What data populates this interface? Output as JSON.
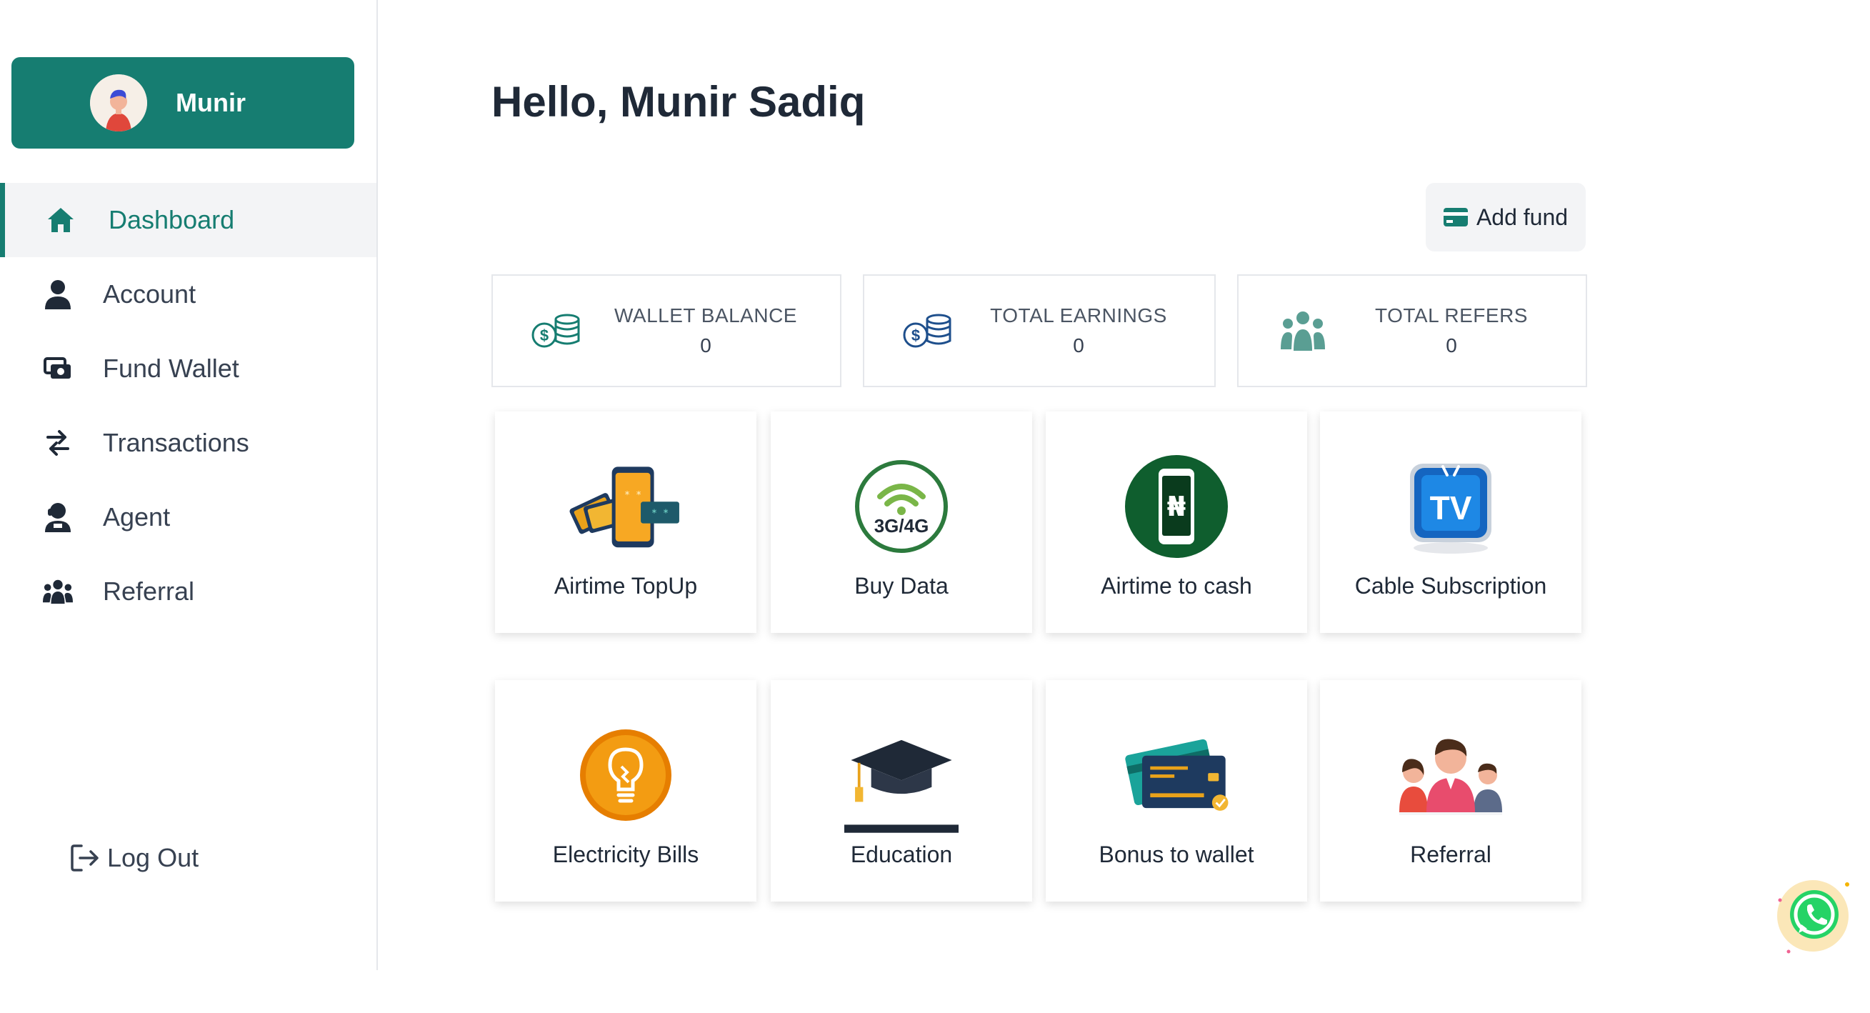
{
  "profile": {
    "name": "Munir"
  },
  "nav": {
    "items": [
      {
        "label": "Dashboard",
        "icon": "home-icon",
        "active": true
      },
      {
        "label": "Account",
        "icon": "user-icon"
      },
      {
        "label": "Fund Wallet",
        "icon": "money-icon"
      },
      {
        "label": "Transactions",
        "icon": "transfer-icon"
      },
      {
        "label": "Agent",
        "icon": "agent-icon"
      },
      {
        "label": "Referral",
        "icon": "users-icon"
      }
    ],
    "logout": "Log Out"
  },
  "main": {
    "greeting": "Hello, Munir Sadiq",
    "add_fund": "Add fund",
    "stats": [
      {
        "label": "WALLET BALANCE",
        "value": "0",
        "icon": "coins-icon"
      },
      {
        "label": "TOTAL EARNINGS",
        "value": "0",
        "icon": "coins-icon"
      },
      {
        "label": "TOTAL REFERS",
        "value": "0",
        "icon": "users-icon"
      }
    ],
    "services": [
      {
        "label": "Airtime TopUp",
        "icon": "phone-topup-icon",
        "icon_text": ""
      },
      {
        "label": "Buy Data",
        "icon": "data-wifi-icon",
        "icon_text": "3G/4G"
      },
      {
        "label": "Airtime to cash",
        "icon": "phone-naira-icon",
        "icon_text": "₦"
      },
      {
        "label": "Cable Subscription",
        "icon": "tv-icon",
        "icon_text": "TV"
      },
      {
        "label": "Electricity Bills",
        "icon": "bulb-icon",
        "icon_text": ""
      },
      {
        "label": "Education",
        "icon": "graduation-cap-icon",
        "icon_text": ""
      },
      {
        "label": "Bonus to wallet",
        "icon": "card-icon",
        "icon_text": ""
      },
      {
        "label": "Referral",
        "icon": "people-icon",
        "icon_text": ""
      }
    ]
  },
  "colors": {
    "brand": "#167d71",
    "text": "#1f2937",
    "muted": "#4b5563",
    "border": "#e5e7eb"
  }
}
